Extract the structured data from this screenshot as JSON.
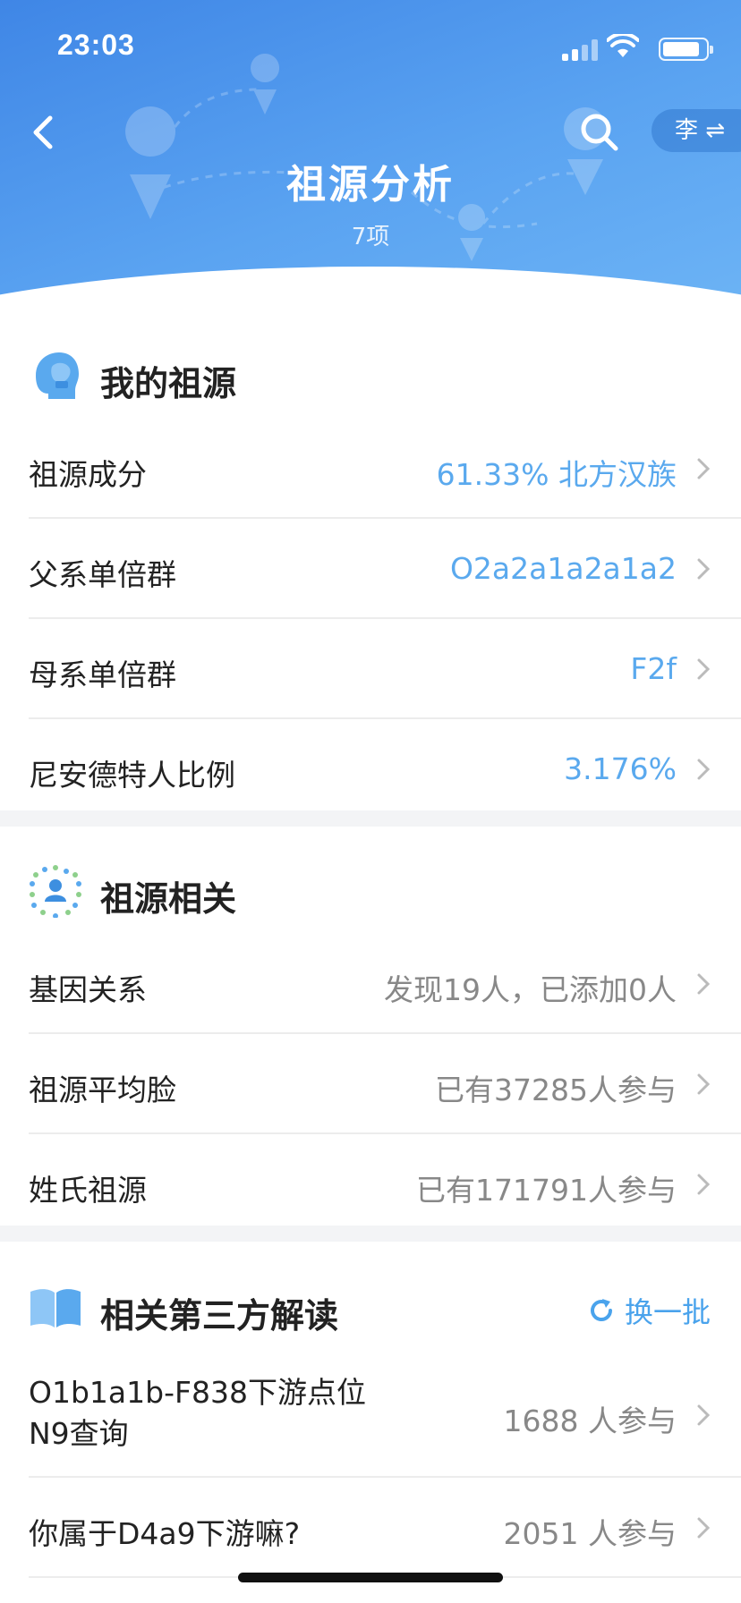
{
  "status": {
    "time": "23:03"
  },
  "header": {
    "title": "祖源分析",
    "subtitle": "7项",
    "switch_label": "李 ⇌"
  },
  "sections": [
    {
      "title": "我的祖源",
      "icon": "head-icon",
      "rows": [
        {
          "label": "祖源成分",
          "value": "61.33% 北方汉族"
        },
        {
          "label": "父系单倍群",
          "value": "O2a2a1a2a1a2"
        },
        {
          "label": "母系单倍群",
          "value": "F2f"
        },
        {
          "label": "尼安德特人比例",
          "value": "3.176%"
        }
      ]
    },
    {
      "title": "祖源相关",
      "icon": "people-network-icon",
      "rows": [
        {
          "label": "基因关系",
          "value": "发现19人，已添加0人"
        },
        {
          "label": "祖源平均脸",
          "value": "已有37285人参与"
        },
        {
          "label": "姓氏祖源",
          "value": "已有171791人参与"
        }
      ]
    },
    {
      "title": "相关第三方解读",
      "icon": "book-icon",
      "refresh_label": "换一批",
      "rows": [
        {
          "label_line1": "O1b1a1b-F838下游点位",
          "label_line2": "N9查询",
          "value": "1688 人参与"
        },
        {
          "label": "你属于D4a9下游嘛?",
          "value": "2051 人参与"
        }
      ]
    }
  ],
  "colors": {
    "accent": "#5aa9ee",
    "header_start": "#3f86e6",
    "header_end": "#6db4f5"
  }
}
